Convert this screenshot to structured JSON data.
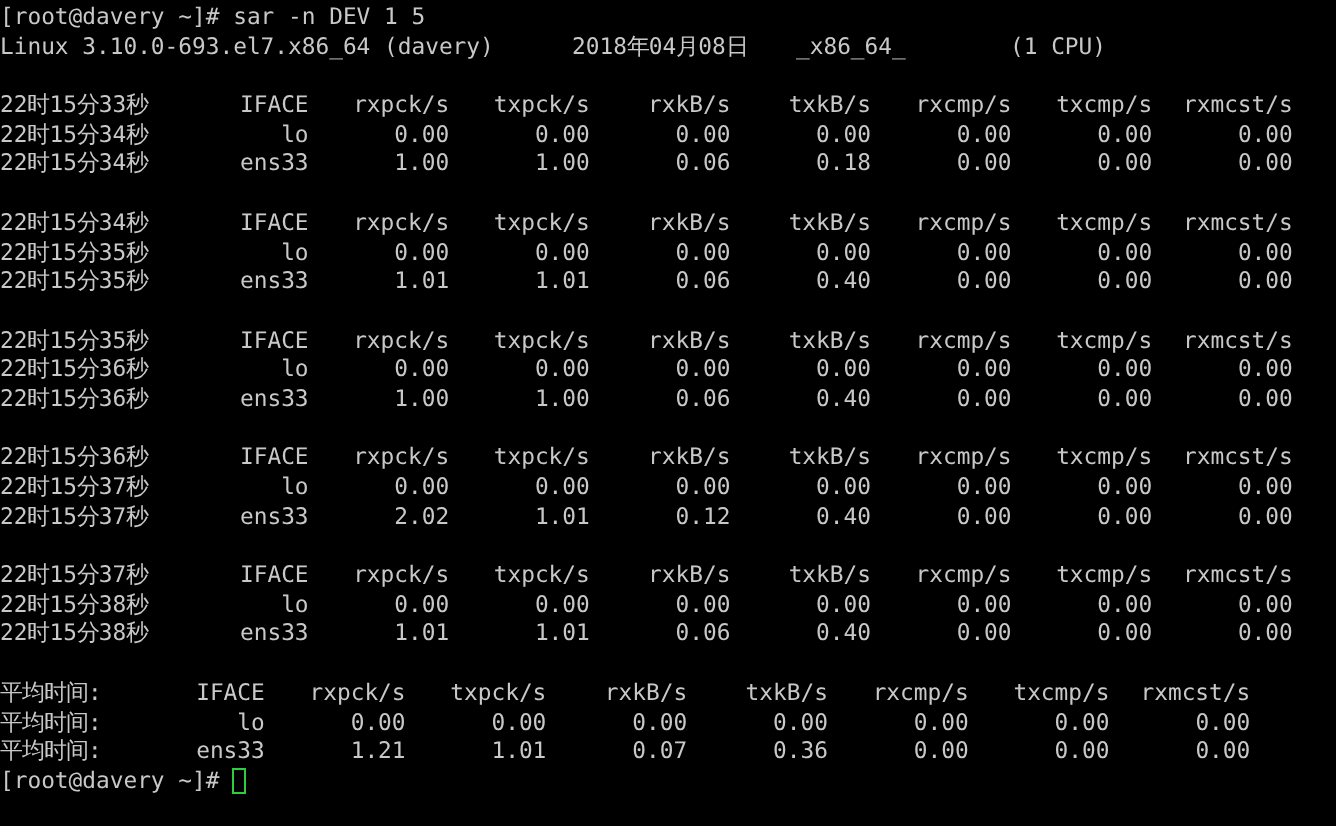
{
  "command_line": "[root@davery ~]# sar -n DEV 1 5",
  "system_info": [
    "Linux 3.10.0-693.el7.x86_64 (davery)",
    "2018年04月08日",
    "_x86_64_",
    "(1 CPU)"
  ],
  "samples": [
    {
      "header": [
        "22时15分33秒",
        "IFACE",
        "rxpck/s",
        "txpck/s",
        "rxkB/s",
        "txkB/s",
        "rxcmp/s",
        "txcmp/s",
        "rxmcst/s"
      ],
      "rows": [
        [
          "22时15分34秒",
          "lo",
          "0.00",
          "0.00",
          "0.00",
          "0.00",
          "0.00",
          "0.00",
          "0.00"
        ],
        [
          "22时15分34秒",
          "ens33",
          "1.00",
          "1.00",
          "0.06",
          "0.18",
          "0.00",
          "0.00",
          "0.00"
        ]
      ]
    },
    {
      "header": [
        "22时15分34秒",
        "IFACE",
        "rxpck/s",
        "txpck/s",
        "rxkB/s",
        "txkB/s",
        "rxcmp/s",
        "txcmp/s",
        "rxmcst/s"
      ],
      "rows": [
        [
          "22时15分35秒",
          "lo",
          "0.00",
          "0.00",
          "0.00",
          "0.00",
          "0.00",
          "0.00",
          "0.00"
        ],
        [
          "22时15分35秒",
          "ens33",
          "1.01",
          "1.01",
          "0.06",
          "0.40",
          "0.00",
          "0.00",
          "0.00"
        ]
      ]
    },
    {
      "header": [
        "22时15分35秒",
        "IFACE",
        "rxpck/s",
        "txpck/s",
        "rxkB/s",
        "txkB/s",
        "rxcmp/s",
        "txcmp/s",
        "rxmcst/s"
      ],
      "rows": [
        [
          "22时15分36秒",
          "lo",
          "0.00",
          "0.00",
          "0.00",
          "0.00",
          "0.00",
          "0.00",
          "0.00"
        ],
        [
          "22时15分36秒",
          "ens33",
          "1.00",
          "1.00",
          "0.06",
          "0.40",
          "0.00",
          "0.00",
          "0.00"
        ]
      ]
    },
    {
      "header": [
        "22时15分36秒",
        "IFACE",
        "rxpck/s",
        "txpck/s",
        "rxkB/s",
        "txkB/s",
        "rxcmp/s",
        "txcmp/s",
        "rxmcst/s"
      ],
      "rows": [
        [
          "22时15分37秒",
          "lo",
          "0.00",
          "0.00",
          "0.00",
          "0.00",
          "0.00",
          "0.00",
          "0.00"
        ],
        [
          "22时15分37秒",
          "ens33",
          "2.02",
          "1.01",
          "0.12",
          "0.40",
          "0.00",
          "0.00",
          "0.00"
        ]
      ]
    },
    {
      "header": [
        "22时15分37秒",
        "IFACE",
        "rxpck/s",
        "txpck/s",
        "rxkB/s",
        "txkB/s",
        "rxcmp/s",
        "txcmp/s",
        "rxmcst/s"
      ],
      "rows": [
        [
          "22时15分38秒",
          "lo",
          "0.00",
          "0.00",
          "0.00",
          "0.00",
          "0.00",
          "0.00",
          "0.00"
        ],
        [
          "22时15分38秒",
          "ens33",
          "1.01",
          "1.01",
          "0.06",
          "0.40",
          "0.00",
          "0.00",
          "0.00"
        ]
      ]
    }
  ],
  "average": {
    "header": [
      "平均时间:",
      "IFACE",
      "rxpck/s",
      "txpck/s",
      "rxkB/s",
      "txkB/s",
      "rxcmp/s",
      "txcmp/s",
      "rxmcst/s"
    ],
    "rows": [
      [
        "平均时间:",
        "lo",
        "0.00",
        "0.00",
        "0.00",
        "0.00",
        "0.00",
        "0.00",
        "0.00"
      ],
      [
        "平均时间:",
        "ens33",
        "1.21",
        "1.01",
        "0.07",
        "0.36",
        "0.00",
        "0.00",
        "0.00"
      ]
    ]
  },
  "prompt": "[root@davery ~]#"
}
